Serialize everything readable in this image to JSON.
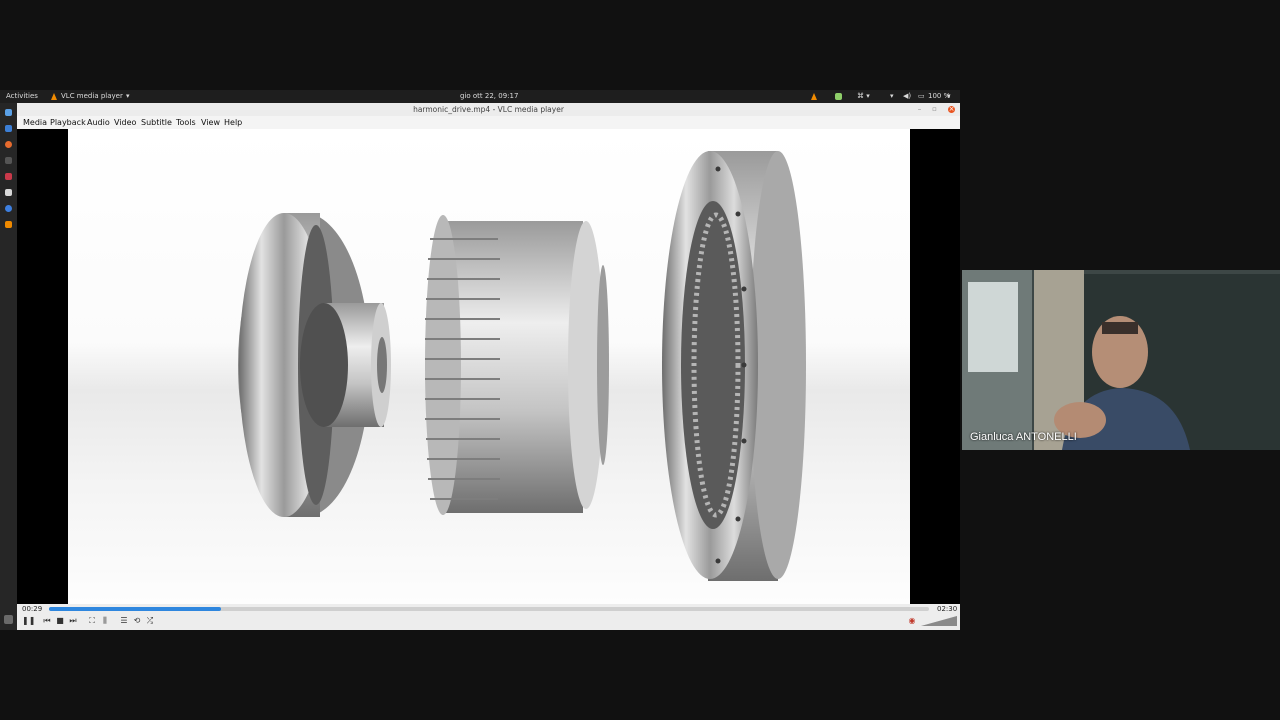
{
  "topbar": {
    "activities": "Activities",
    "app_name": "VLC media player",
    "clock": "gio ott 22, 09:17",
    "battery": "100 %"
  },
  "window": {
    "title": "harmonic_drive.mp4 - VLC media player"
  },
  "menu": [
    "Media",
    "Playback",
    "Audio",
    "Video",
    "Subtitle",
    "Tools",
    "View",
    "Help"
  ],
  "player": {
    "elapsed": "00:29",
    "total": "02:30",
    "progress": 0.195,
    "volume": 1.0,
    "accent_color": "#2e86de"
  },
  "participant": {
    "name": "Gianluca ANTONELLI"
  },
  "icons": {
    "vlc": "vlc-cone-icon",
    "close": "close-icon",
    "pause": "pause-icon",
    "stop": "stop-icon"
  }
}
